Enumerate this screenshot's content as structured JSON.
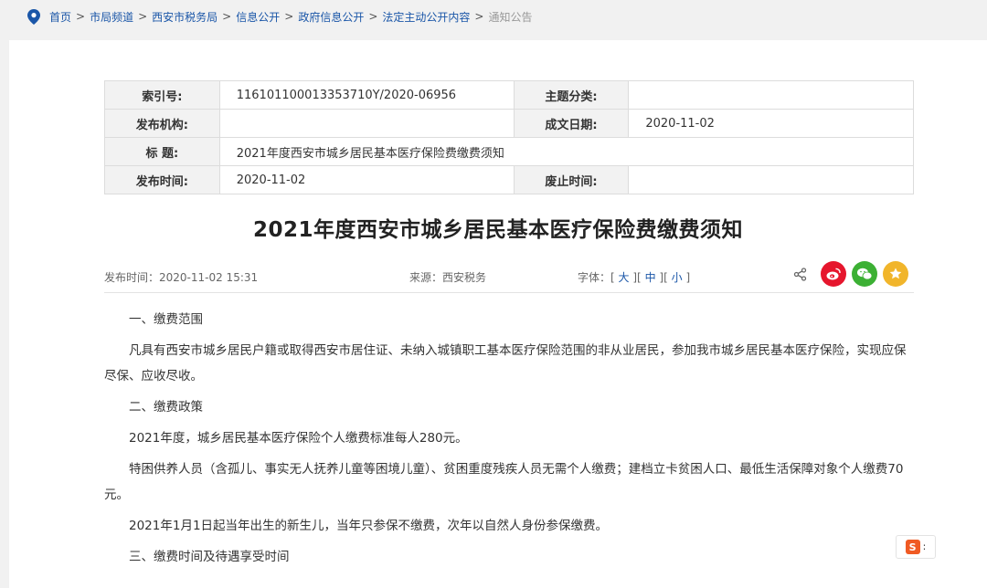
{
  "breadcrumb": {
    "items": [
      "首页",
      "市局频道",
      "西安市税务局",
      "信息公开",
      "政府信息公开",
      "法定主动公开内容"
    ],
    "separator": ">",
    "current": "通知公告"
  },
  "meta": {
    "index_label": "索引号:",
    "index_value": "116101100013353710Y/2020-06956",
    "topic_label": "主题分类:",
    "topic_value": "",
    "agency_label": "发布机构:",
    "agency_value": "",
    "created_label": "成文日期:",
    "created_value": "2020-11-02",
    "title_label": "标 题:",
    "title_value": "2021年度西安市城乡居民基本医疗保险费缴费须知",
    "published_label": "发布时间:",
    "published_value": "2020-11-02",
    "expire_label": "废止时间:",
    "expire_value": ""
  },
  "article": {
    "title": "2021年度西安市城乡居民基本医疗保险费缴费须知",
    "publish_time": "发布时间：2020-11-02 15:31",
    "source_label": "来源：",
    "source": "西安税务",
    "font_label": "字体：",
    "font_open": "[",
    "font_large": "大",
    "font_medium": "中",
    "font_small": "小",
    "font_mid_sep": "][",
    "font_close": "]",
    "paragraphs": [
      "一、缴费范围",
      "凡具有西安市城乡居民户籍或取得西安市居住证、未纳入城镇职工基本医疗保险范围的非从业居民，参加我市城乡居民基本医疗保险，实现应保尽保、应收尽收。",
      "二、缴费政策",
      "2021年度，城乡居民基本医疗保险个人缴费标准每人280元。",
      "特困供养人员（含孤儿、事实无人抚养儿童等困境儿童）、贫困重度残疾人员无需个人缴费；建档立卡贫困人口、最低生活保障对象个人缴费70元。",
      "2021年1月1日起当年出生的新生儿，当年只参保不缴费，次年以自然人身份参保缴费。",
      "三、缴费时间及待遇享受时间"
    ]
  },
  "share": {
    "icons": [
      "share-icon",
      "weibo-icon",
      "wechat-icon",
      "favorite-icon"
    ]
  },
  "ime": {
    "badge": "S",
    "dots": ":"
  },
  "colors": {
    "link": "#1a56a8",
    "weibo": "#e6162d",
    "wechat": "#3cb034",
    "favorite": "#f1b52b"
  }
}
